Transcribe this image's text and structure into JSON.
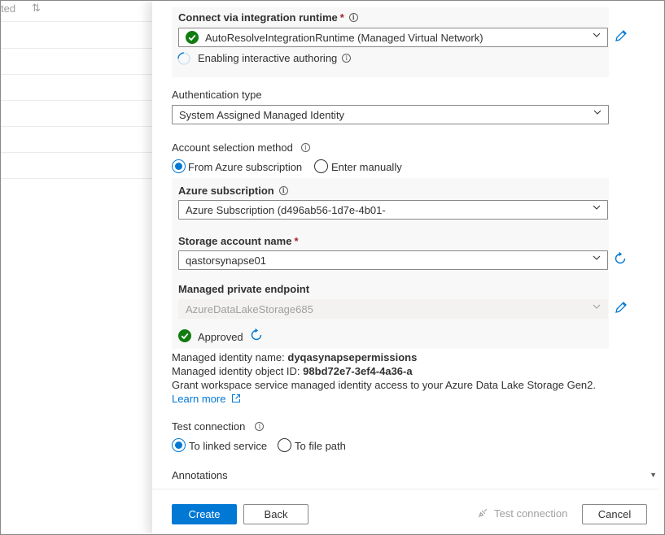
{
  "background_list": {
    "header_text": "ted",
    "sort_icon": "sort-arrows-icon"
  },
  "integration_runtime": {
    "label": "Connect via integration runtime",
    "required_mark": "*",
    "value": "AutoResolveIntegrationRuntime (Managed Virtual Network)",
    "interactive_authoring_text": "Enabling interactive authoring"
  },
  "authentication": {
    "label": "Authentication type",
    "value": "System Assigned Managed Identity"
  },
  "account_selection": {
    "label": "Account selection method",
    "options": [
      "From Azure subscription",
      "Enter manually"
    ],
    "selected": "From Azure subscription"
  },
  "azure_subscription": {
    "label": "Azure subscription",
    "value": "Azure Subscription (d496ab56-1d7e-4b01-"
  },
  "storage_account": {
    "label": "Storage account name",
    "required_mark": "*",
    "value": "qastorsynapse01"
  },
  "private_endpoint": {
    "label": "Managed private endpoint",
    "value": "AzureDataLakeStorage685",
    "status": "Approved"
  },
  "managed_identity": {
    "name_label": "Managed identity name:",
    "name_value": "dyqasynapsepermissions",
    "object_id_label": "Managed identity object ID:",
    "object_id_value": "98bd72e7-3ef4-4a36-a",
    "grant_text": "Grant workspace service managed identity access to your Azure Data Lake Storage Gen2.",
    "learn_more": "Learn more"
  },
  "test_connection": {
    "label": "Test connection",
    "options": [
      "To linked service",
      "To file path"
    ],
    "selected": "To linked service"
  },
  "annotations": {
    "label": "Annotations"
  },
  "footer": {
    "create": "Create",
    "back": "Back",
    "test_connection": "Test connection",
    "cancel": "Cancel"
  },
  "colors": {
    "accent": "#0078d4",
    "success": "#107c10",
    "required": "#a4262c"
  }
}
